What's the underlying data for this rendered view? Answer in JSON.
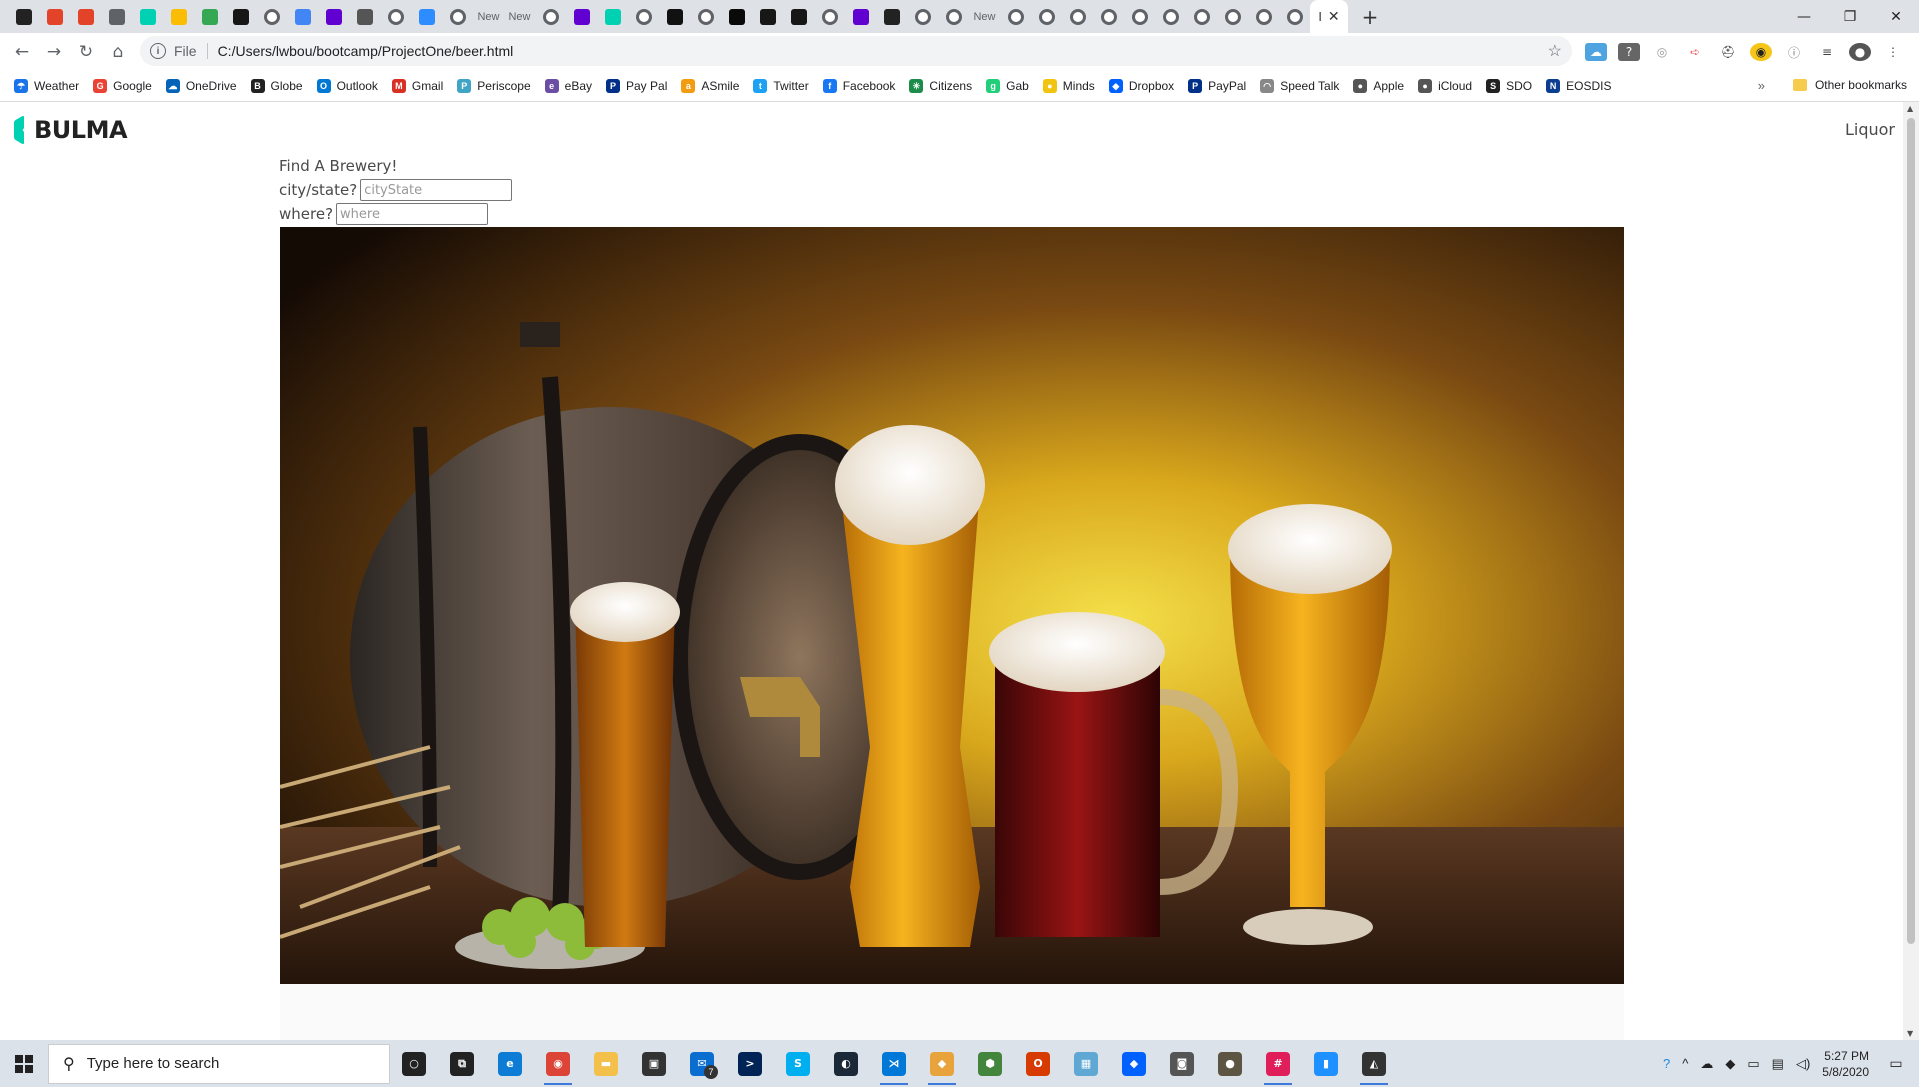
{
  "browser": {
    "tabs": [
      {
        "icon": "red-dark-icon",
        "color": "#222"
      },
      {
        "icon": "gitlab-icon",
        "color": "#e24329"
      },
      {
        "icon": "gitlab-icon",
        "color": "#e24329"
      },
      {
        "icon": "audio-tab-icon",
        "color": "#5f6368"
      },
      {
        "icon": "bulma-icon",
        "color": "#00d1b2"
      },
      {
        "icon": "keep-icon",
        "color": "#fbbc04"
      },
      {
        "icon": "drive-icon",
        "color": "#34a853"
      },
      {
        "icon": "github-icon",
        "color": "#181717"
      },
      {
        "icon": "default-globe-icon",
        "color": "#5f6368"
      },
      {
        "icon": "docs-icon",
        "color": "#4285f4"
      },
      {
        "icon": "yahoo-icon",
        "color": "#6001d2"
      },
      {
        "icon": "diamond-icon",
        "color": "#555"
      },
      {
        "icon": "default-globe-icon",
        "color": "#5f6368"
      },
      {
        "icon": "zoom-icon",
        "color": "#2d8cff"
      },
      {
        "icon": "default-globe-icon",
        "color": "#5f6368"
      },
      {
        "icon": "new-tab-icon",
        "text": "New"
      },
      {
        "icon": "new-tab-icon",
        "text": "New"
      },
      {
        "icon": "default-globe-icon",
        "color": "#5f6368"
      },
      {
        "icon": "yahoo-icon",
        "color": "#6001d2"
      },
      {
        "icon": "bulma-icon",
        "color": "#00d1b2"
      },
      {
        "icon": "default-globe-icon",
        "color": "#5f6368"
      },
      {
        "icon": "medium-icon",
        "color": "#111"
      },
      {
        "icon": "default-globe-icon",
        "color": "#5f6368"
      },
      {
        "icon": "dev-icon",
        "color": "#0a0a0a"
      },
      {
        "icon": "github-icon",
        "color": "#181717"
      },
      {
        "icon": "github-icon",
        "color": "#181717"
      },
      {
        "icon": "default-globe-icon",
        "color": "#5f6368"
      },
      {
        "icon": "yahoo-icon",
        "color": "#6001d2"
      },
      {
        "icon": "dots-icon",
        "color": "#222"
      },
      {
        "icon": "default-globe-icon",
        "color": "#5f6368"
      },
      {
        "icon": "default-globe-icon",
        "color": "#5f6368"
      },
      {
        "icon": "new-tab-icon",
        "text": "New"
      },
      {
        "icon": "default-globe-icon",
        "color": "#5f6368"
      },
      {
        "icon": "default-globe-icon",
        "color": "#5f6368"
      },
      {
        "icon": "default-globe-icon",
        "color": "#5f6368"
      },
      {
        "icon": "default-globe-icon",
        "color": "#5f6368"
      },
      {
        "icon": "default-globe-icon",
        "color": "#5f6368"
      },
      {
        "icon": "default-globe-icon",
        "color": "#5f6368"
      },
      {
        "icon": "default-globe-icon",
        "color": "#5f6368"
      },
      {
        "icon": "default-globe-icon",
        "color": "#5f6368"
      },
      {
        "icon": "default-globe-icon",
        "color": "#5f6368"
      },
      {
        "icon": "default-globe-icon",
        "color": "#5f6368"
      }
    ],
    "active_tab_text": "I",
    "new_tab_symbol": "+",
    "window_controls": {
      "minimize": "—",
      "restore": "❐",
      "close": "✕"
    },
    "url_scheme_label": "File",
    "url": "C:/Users/lwbou/bootcamp/ProjectOne/beer.html",
    "bookmarks": [
      {
        "label": "Weather",
        "color": "#1a73e8",
        "glyph": "☂"
      },
      {
        "label": "Google",
        "color": "#ea4335",
        "glyph": "G"
      },
      {
        "label": "OneDrive",
        "color": "#0364b8",
        "glyph": "☁"
      },
      {
        "label": "Globe",
        "color": "#222",
        "glyph": "B"
      },
      {
        "label": "Outlook",
        "color": "#0078d4",
        "glyph": "O"
      },
      {
        "label": "Gmail",
        "color": "#d93025",
        "glyph": "M"
      },
      {
        "label": "Periscope",
        "color": "#40a4c4",
        "glyph": "P"
      },
      {
        "label": "eBay",
        "color": "#6b4ea3",
        "glyph": "e"
      },
      {
        "label": "Pay Pal",
        "color": "#003087",
        "glyph": "P"
      },
      {
        "label": "ASmile",
        "color": "#f39c12",
        "glyph": "a"
      },
      {
        "label": "Twitter",
        "color": "#1da1f2",
        "glyph": "t"
      },
      {
        "label": "Facebook",
        "color": "#1877f2",
        "glyph": "f"
      },
      {
        "label": "Citizens",
        "color": "#1d8c4a",
        "glyph": "✳"
      },
      {
        "label": "Gab",
        "color": "#21cf7a",
        "glyph": "g"
      },
      {
        "label": "Minds",
        "color": "#f1c40f",
        "glyph": "●"
      },
      {
        "label": "Dropbox",
        "color": "#0061ff",
        "glyph": "◆"
      },
      {
        "label": "PayPal",
        "color": "#003087",
        "glyph": "P"
      },
      {
        "label": "Speed Talk",
        "color": "#888",
        "glyph": "◠"
      },
      {
        "label": "Apple",
        "color": "#555",
        "glyph": "●"
      },
      {
        "label": "iCloud",
        "color": "#555",
        "glyph": "●"
      },
      {
        "label": "SDO",
        "color": "#222",
        "glyph": "S"
      },
      {
        "label": "EOSDIS",
        "color": "#0b3d91",
        "glyph": "N"
      }
    ],
    "bookmarks_overflow": "»",
    "other_bookmarks": "Other bookmarks"
  },
  "page": {
    "brand": "BULMA",
    "nav_link": "Liquor",
    "heading": "Find A Brewery!",
    "city_label": "city/state?",
    "city_placeholder": "cityState",
    "where_label": "where?",
    "where_placeholder": "where",
    "hero_image": "beer-barrel-and-glasses-photo"
  },
  "taskbar": {
    "search_placeholder": "Type here to search",
    "apps": [
      {
        "icon": "cortana-icon",
        "color": "#222",
        "glyph": "○"
      },
      {
        "icon": "task-view-icon",
        "color": "#222",
        "glyph": "⧉"
      },
      {
        "icon": "edge-icon",
        "color": "#0c7cd5",
        "glyph": "e"
      },
      {
        "icon": "chrome-icon",
        "color": "#db4437",
        "glyph": "◉",
        "open": true
      },
      {
        "icon": "file-explorer-icon",
        "color": "#f3c04b",
        "glyph": "▬"
      },
      {
        "icon": "store-icon",
        "color": "#333",
        "glyph": "▣"
      },
      {
        "icon": "mail-icon",
        "color": "#0a6ed1",
        "glyph": "✉"
      },
      {
        "icon": "powershell-icon",
        "color": "#012456",
        "glyph": ">"
      },
      {
        "icon": "skype-icon",
        "color": "#00aff0",
        "glyph": "S"
      },
      {
        "icon": "steam-icon",
        "color": "#1b2838",
        "glyph": "◐"
      },
      {
        "icon": "vscode-icon",
        "color": "#0078d7",
        "glyph": "⋊",
        "open": true
      },
      {
        "icon": "sourcetree-icon",
        "color": "#e8a33d",
        "glyph": "◆",
        "open": true
      },
      {
        "icon": "node-icon",
        "color": "#43853d",
        "glyph": "⬢"
      },
      {
        "icon": "office-icon",
        "color": "#d83b01",
        "glyph": "O"
      },
      {
        "icon": "remote-desktop-icon",
        "color": "#5fa8d3",
        "glyph": "▦"
      },
      {
        "icon": "dropbox-icon",
        "color": "#0061ff",
        "glyph": "◆"
      },
      {
        "icon": "camera-icon",
        "color": "#555",
        "glyph": "◙"
      },
      {
        "icon": "gimp-icon",
        "color": "#5c5543",
        "glyph": "●"
      },
      {
        "icon": "slack-icon",
        "color": "#e01e5a",
        "glyph": "#",
        "open": true
      },
      {
        "icon": "phone-icon",
        "color": "#1e90ff",
        "glyph": "▮"
      },
      {
        "icon": "photos-icon",
        "color": "#333",
        "glyph": "◭",
        "open": true
      }
    ],
    "mail_badge": "7",
    "time": "5:27 PM",
    "date": "5/8/2020"
  }
}
